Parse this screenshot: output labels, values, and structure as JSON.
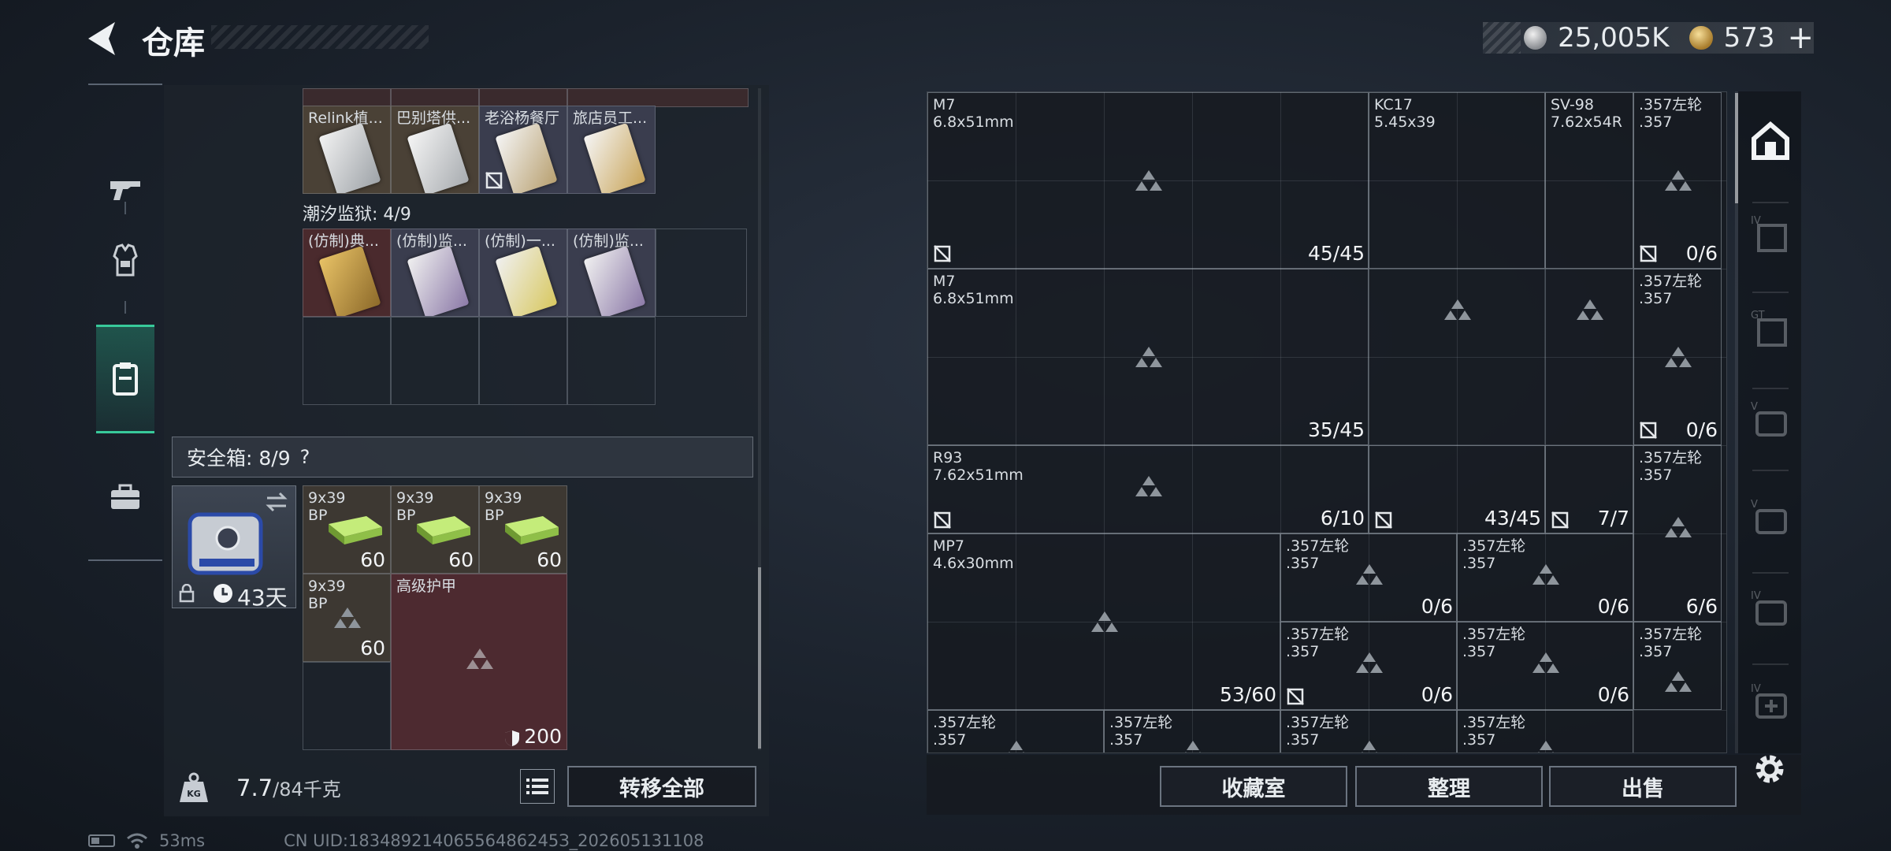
{
  "header": {
    "title": "仓库",
    "silver_amount": "25,005K",
    "gold_amount": "573",
    "plus_label": "+"
  },
  "left_panel": {
    "top_items": [
      "Relink植...",
      "巴别塔供...",
      "老浴杨餐厅",
      "旅店员工..."
    ],
    "prison_label": "潮汐监狱: 4/9",
    "prison_items": [
      "(仿制)典...",
      "(仿制)监...",
      "(仿制)一...",
      "(仿制)监..."
    ],
    "safebox_label": "安全箱: 8/9",
    "safebox_help": "?",
    "safebox_timer": "43天",
    "ammo": [
      {
        "label": "9x39\nBP",
        "count": "60"
      },
      {
        "label": "9x39\nBP",
        "count": "60"
      },
      {
        "label": "9x39\nBP",
        "count": "60"
      },
      {
        "label": "9x39\nBP",
        "count": "60"
      }
    ],
    "armor_label": "高级护甲",
    "armor_value": "200",
    "weight_value": "7.7",
    "weight_max": "/84千克",
    "transfer_all": "转移全部"
  },
  "status_bar": {
    "ping": "53ms",
    "uid": "CN UID:18348921406556486245З_202605131108"
  },
  "right_grid": {
    "slots": [
      {
        "l1": "M7",
        "l2": "6.8x51mm",
        "count": "45/45"
      },
      {
        "l1": "KC17",
        "l2": "5.45x39",
        "count": ""
      },
      {
        "l1": "SV-98",
        "l2": "7.62x54R",
        "count": ""
      },
      {
        "l1": ".357左轮",
        "l2": ".357",
        "count": "0/6"
      },
      {
        "l1": "M7",
        "l2": "6.8x51mm",
        "count": "35/45"
      },
      {
        "l1": ".357左轮",
        "l2": ".357",
        "count": "0/6"
      },
      {
        "l1": "R93",
        "l2": "7.62x51mm",
        "count": "6/10"
      },
      {
        "l1": "",
        "l2": "",
        "count": "43/45"
      },
      {
        "l1": "",
        "l2": "",
        "count": "7/7"
      },
      {
        "l1": ".357左轮",
        "l2": ".357",
        "count": ""
      },
      {
        "l1": "MP7",
        "l2": "4.6x30mm",
        "count": "53/60"
      },
      {
        "l1": ".357左轮",
        "l2": ".357",
        "count": "0/6"
      },
      {
        "l1": ".357左轮",
        "l2": ".357",
        "count": "0/6"
      },
      {
        "l1": "",
        "l2": "",
        "count": "6/6"
      },
      {
        "l1": ".357左轮",
        "l2": ".357",
        "count": "0/6"
      },
      {
        "l1": ".357左轮",
        "l2": ".357",
        "count": "0/6"
      },
      {
        "l1": ".357左轮",
        "l2": ".357",
        "count": ""
      },
      {
        "l1": ".357左轮",
        "l2": ".357",
        "count": ""
      },
      {
        "l1": ".357左轮",
        "l2": ".357",
        "count": ""
      },
      {
        "l1": ".357左轮",
        "l2": ".357",
        "count": ""
      },
      {
        "l1": ".357左轮",
        "l2": ".357",
        "count": ""
      }
    ]
  },
  "right_buttons": {
    "collection": "收藏室",
    "sort": "整理",
    "sell": "出售"
  },
  "right_sidebar": {
    "tags": [
      "IV",
      "GT",
      "V",
      "V",
      "IV",
      "IV"
    ]
  },
  "colors": {
    "accent_green": "#38c99a",
    "armor_red": "#5a2a30",
    "ammo_box_green": "#9bd64a"
  }
}
